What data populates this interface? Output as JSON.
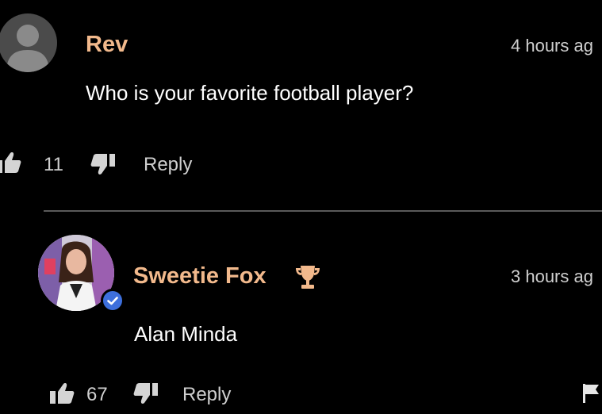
{
  "comment": {
    "username": "Rev",
    "timestamp": "4 hours ag",
    "text": "Who is your favorite football player?",
    "likes": "11",
    "reply_label": "Reply"
  },
  "reply": {
    "username": "Sweetie Fox",
    "timestamp": "3 hours ag",
    "text": "Alan Minda",
    "likes": "67",
    "reply_label": "Reply"
  },
  "colors": {
    "username": "#f2b98c",
    "verified_badge": "#3d6fdc",
    "background": "#000000"
  }
}
